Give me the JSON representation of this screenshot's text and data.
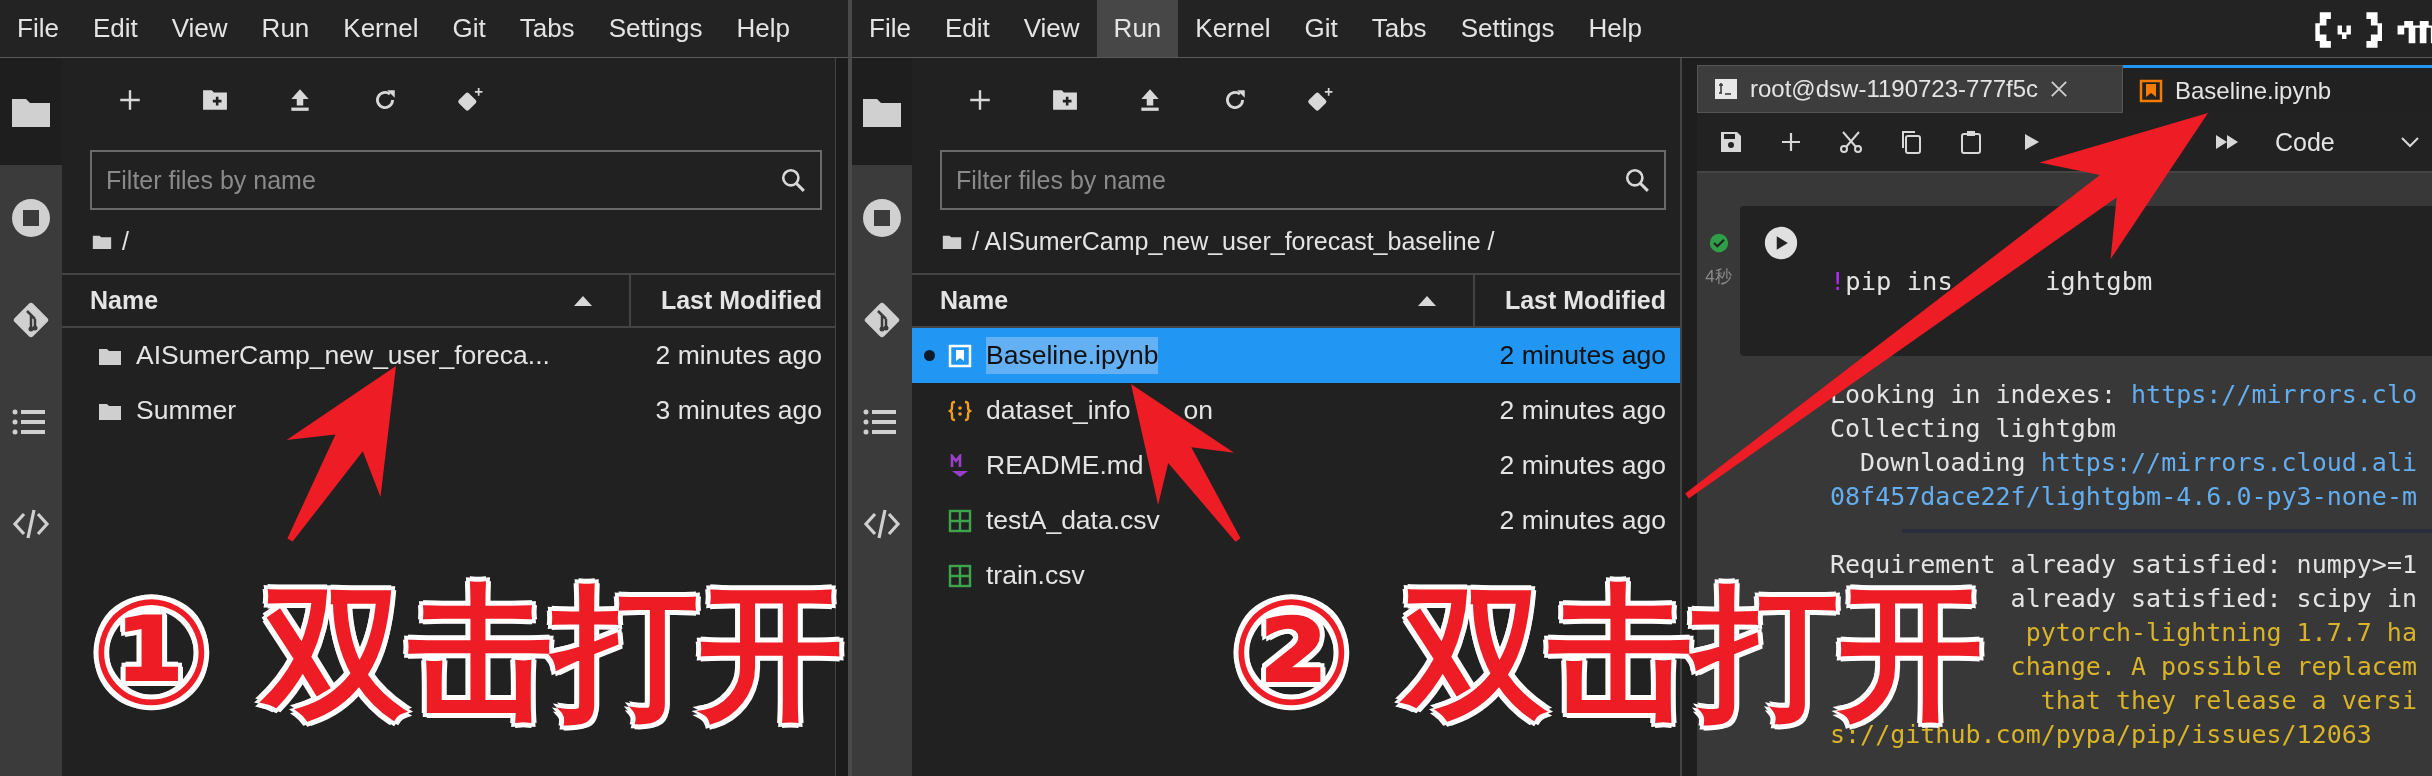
{
  "panels": [
    {
      "menu": [
        {
          "label": "File",
          "selected": false
        },
        {
          "label": "Edit",
          "selected": false
        },
        {
          "label": "View",
          "selected": false
        },
        {
          "label": "Run",
          "selected": false
        },
        {
          "label": "Kernel",
          "selected": false
        },
        {
          "label": "Git",
          "selected": false
        },
        {
          "label": "Tabs",
          "selected": false
        },
        {
          "label": "Settings",
          "selected": false
        },
        {
          "label": "Help",
          "selected": false
        }
      ],
      "filter": {
        "placeholder": "Filter files by name"
      },
      "breadcrumb": "/",
      "columns": [
        "Name",
        "Last Modified"
      ],
      "rows": [
        {
          "kind": "folder",
          "name": "AISumerCamp_new_user_foreca...",
          "modified": "2 minutes ago",
          "selected": false,
          "running": false
        },
        {
          "kind": "folder",
          "name": "Summer",
          "modified": "3 minutes ago",
          "selected": false,
          "running": false
        }
      ]
    },
    {
      "menu": [
        {
          "label": "File",
          "selected": false
        },
        {
          "label": "Edit",
          "selected": false
        },
        {
          "label": "View",
          "selected": false
        },
        {
          "label": "Run",
          "selected": true
        },
        {
          "label": "Kernel",
          "selected": false
        },
        {
          "label": "Git",
          "selected": false
        },
        {
          "label": "Tabs",
          "selected": false
        },
        {
          "label": "Settings",
          "selected": false
        },
        {
          "label": "Help",
          "selected": false
        }
      ],
      "filter": {
        "placeholder": "Filter files by name"
      },
      "breadcrumb": "/ AISumerCamp_new_user_forecast_baseline /",
      "columns": [
        "Name",
        "Last Modified"
      ],
      "rows": [
        {
          "kind": "notebook",
          "name": "Baseline.ipynb",
          "modified": "2 minutes ago",
          "selected": true,
          "running": true
        },
        {
          "kind": "json",
          "name": "dataset_info",
          "name_tail": "on",
          "modified": "2 minutes ago",
          "selected": false,
          "running": false
        },
        {
          "kind": "markdown",
          "name": "README.md",
          "modified": "2 minutes ago",
          "selected": false,
          "running": false
        },
        {
          "kind": "csv",
          "name": "testA_data.csv",
          "modified": "2 minutes ago",
          "selected": false,
          "running": false
        },
        {
          "kind": "csv",
          "name": "train.csv",
          "selected": false,
          "running": false
        }
      ]
    }
  ],
  "notebook": {
    "tabs": [
      {
        "kind": "terminal",
        "label": "root@dsw-1190723-777f5c",
        "selected": false,
        "closable": true
      },
      {
        "kind": "notebook",
        "label": "Baseline.ipynb",
        "selected": true,
        "closable": false
      }
    ],
    "cell_type": "Code",
    "cell": {
      "succeeded": true,
      "elapsed": "4秒",
      "code": [
        {
          "kind": "magic",
          "text": "!"
        },
        {
          "kind": "plain",
          "text": "pip ins"
        },
        {
          "kind": "plain",
          "text": "ightgbm"
        }
      ]
    },
    "output": [
      {
        "kind": "text",
        "parts": [
          {
            "kind": "plain",
            "text": "Looking in indexes: "
          },
          {
            "kind": "link",
            "text": "https://mirrors.clo"
          }
        ]
      },
      {
        "kind": "text",
        "parts": [
          {
            "kind": "plain",
            "text": "Collecting lightgbm"
          }
        ]
      },
      {
        "kind": "text",
        "parts": [
          {
            "kind": "plain",
            "text": "  Downloading "
          },
          {
            "kind": "link",
            "text": "https://mirrors.cloud.ali"
          }
        ]
      },
      {
        "kind": "text",
        "parts": [
          {
            "kind": "link",
            "text": "08f457dace22f/lightgbm-4.6.0-py3-none-m"
          }
        ]
      },
      {
        "kind": "progress",
        "level": 1
      },
      {
        "kind": "text",
        "parts": [
          {
            "kind": "plain",
            "text": "Requirement already satisfied: numpy>=1"
          }
        ]
      },
      {
        "kind": "tail",
        "parts": [
          {
            "kind": "plain",
            "text": "already satisfied: scipy in"
          }
        ]
      },
      {
        "kind": "tail",
        "parts": [
          {
            "kind": "warn",
            "text": "pytorch-lightning 1.7.7 ha"
          }
        ]
      },
      {
        "kind": "tail",
        "parts": [
          {
            "kind": "warn",
            "text": "change. A possible replacem"
          }
        ]
      },
      {
        "kind": "tail",
        "parts": [
          {
            "kind": "warn",
            "text": "that they release a versi"
          }
        ]
      },
      {
        "kind": "text",
        "parts": [
          {
            "kind": "warn",
            "text": "s://github.com/pypa/pip/issues/12063"
          }
        ]
      }
    ]
  },
  "annotations": [
    {
      "text": "① 双击打开"
    },
    {
      "text": "② 双击打开"
    }
  ]
}
